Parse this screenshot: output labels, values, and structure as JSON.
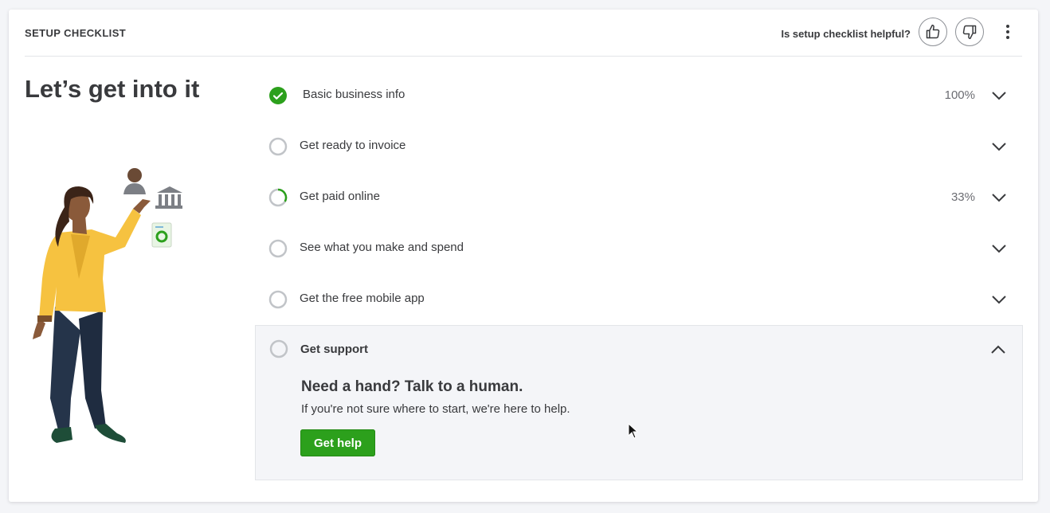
{
  "header": {
    "title": "SETUP CHECKLIST",
    "helpful_question": "Is setup checklist helpful?"
  },
  "hero": {
    "title": "Let’s get into it"
  },
  "checklist": {
    "items": [
      {
        "label": "Basic business info",
        "status": "complete",
        "progress": "100%"
      },
      {
        "label": "Get ready to invoice",
        "status": "not-started",
        "progress": ""
      },
      {
        "label": "Get paid online",
        "status": "in-progress",
        "progress": "33%"
      },
      {
        "label": "See what you make and spend",
        "status": "not-started",
        "progress": ""
      },
      {
        "label": "Get the free mobile app",
        "status": "not-started",
        "progress": ""
      }
    ],
    "expanded_item": {
      "label": "Get support",
      "status": "not-started",
      "heading": "Need a hand? Talk to a human.",
      "subtext": "If you're not sure where to start, we're here to help.",
      "button_label": "Get help"
    }
  },
  "colors": {
    "brand_green": "#2ca01c",
    "text": "#393a3d",
    "muted_text": "#6b6c72",
    "panel_bg": "#f4f5f8",
    "ring_gray": "#c1c4c8"
  },
  "icons": [
    "thumbs-up-icon",
    "thumbs-down-icon",
    "more-vertical-icon",
    "check-circle-icon",
    "empty-circle-icon",
    "progress-ring-icon",
    "chevron-down-icon",
    "chevron-up-icon",
    "mouse-pointer-icon"
  ]
}
